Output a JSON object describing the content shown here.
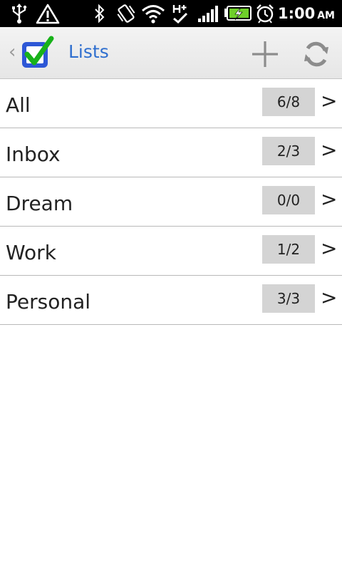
{
  "status_bar": {
    "time": "1:00",
    "ampm": "AM",
    "icons": [
      "usb-icon",
      "warning-icon",
      "bluetooth-icon",
      "vibrate-icon",
      "wifi-icon",
      "hsdpa-plus-icon",
      "signal-icon",
      "battery-charging-icon",
      "alarm-icon"
    ]
  },
  "action_bar": {
    "title": "Lists",
    "title_color": "#2f6fcf",
    "back_glyph": "‹",
    "icons": [
      "app-logo-checkbox-icon",
      "plus-icon",
      "refresh-icon"
    ]
  },
  "lists": [
    {
      "label": "All",
      "count": "6/8",
      "chevron": ">"
    },
    {
      "label": "Inbox",
      "count": "2/3",
      "chevron": ">"
    },
    {
      "label": "Dream",
      "count": "0/0",
      "chevron": ">"
    },
    {
      "label": "Work",
      "count": "1/2",
      "chevron": ">"
    },
    {
      "label": "Personal",
      "count": "3/3",
      "chevron": ">"
    }
  ],
  "colors": {
    "status_bar_bg": "#000000",
    "count_badge_bg": "#d4d4d4",
    "logo_blue": "#2d57d6",
    "logo_check_green": "#18b21a"
  }
}
